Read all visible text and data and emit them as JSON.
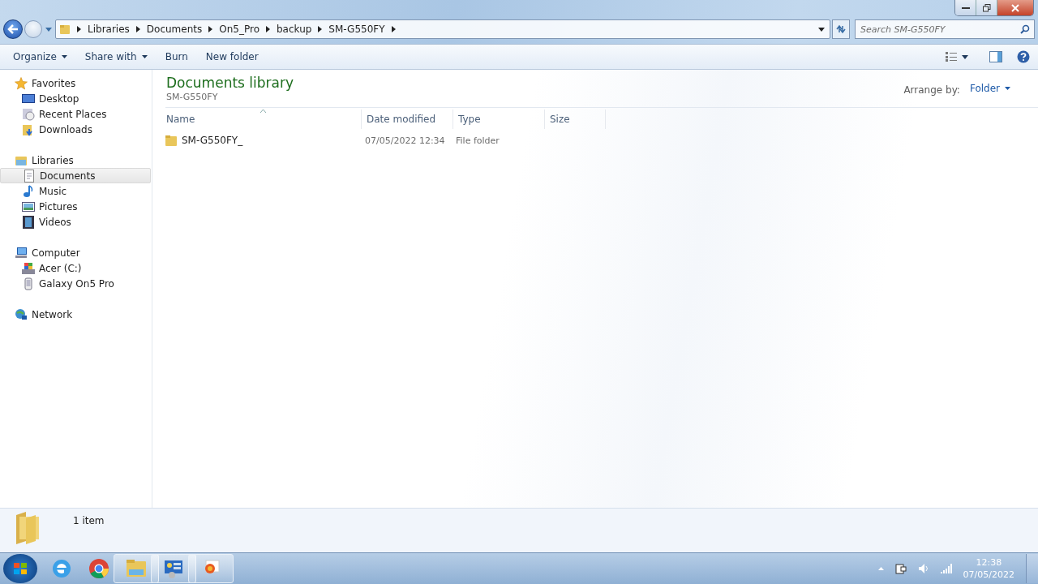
{
  "address_bar": {
    "crumbs": [
      "Libraries",
      "Documents",
      "On5_Pro",
      "backup",
      "SM-G550FY"
    ]
  },
  "search": {
    "placeholder": "Search SM-G550FY"
  },
  "toolbar": [
    {
      "label": "Organize",
      "kind": "menu"
    },
    {
      "label": "Share with",
      "kind": "menu"
    },
    {
      "label": "Burn",
      "kind": "plain"
    },
    {
      "label": "New folder",
      "kind": "plain"
    }
  ],
  "sidebar": {
    "groups": [
      {
        "label": "Favorites",
        "kind": "star",
        "selected": false,
        "children": [
          {
            "label": "Desktop",
            "kind": "desktop",
            "selected": false
          },
          {
            "label": "Recent Places",
            "kind": "recent",
            "selected": false
          },
          {
            "label": "Downloads",
            "kind": "downloads",
            "selected": false
          }
        ]
      },
      {
        "label": "Libraries",
        "kind": "libraries",
        "selected": false,
        "children": [
          {
            "label": "Documents",
            "kind": "document",
            "selected": true
          },
          {
            "label": "Music",
            "kind": "music",
            "selected": false
          },
          {
            "label": "Pictures",
            "kind": "pictures",
            "selected": false
          },
          {
            "label": "Videos",
            "kind": "videos",
            "selected": false
          }
        ]
      },
      {
        "label": "Computer",
        "kind": "computer",
        "selected": false,
        "children": [
          {
            "label": "Acer (C:)",
            "kind": "drive",
            "selected": false
          },
          {
            "label": "Galaxy On5 Pro",
            "kind": "phone",
            "selected": false
          }
        ]
      },
      {
        "label": "Network",
        "kind": "network",
        "selected": false
      }
    ]
  },
  "library": {
    "title": "Documents library",
    "subtitle": "SM-G550FY",
    "arrange_label": "Arrange by:",
    "arrange_value": "Folder"
  },
  "table": {
    "columns": [
      {
        "label": "Name",
        "sorted": true
      },
      {
        "label": "Date modified",
        "sorted": false
      },
      {
        "label": "Type",
        "sorted": false
      },
      {
        "label": "Size",
        "sorted": false
      }
    ],
    "rows": [
      {
        "name": "SM-G550FY_",
        "date": "07/05/2022 12:34",
        "type": "File folder",
        "selected": false
      }
    ]
  },
  "status_bar": {
    "count": "1 item"
  },
  "taskbar": {
    "apps": [
      {
        "kind": "ie",
        "running": false
      },
      {
        "kind": "chrome",
        "running": false
      },
      {
        "kind": "explorer",
        "running": true
      },
      {
        "kind": "control",
        "running": true
      },
      {
        "kind": "photos",
        "running": true
      }
    ],
    "clock": {
      "time": "12:38",
      "date": "07/05/2022"
    }
  }
}
